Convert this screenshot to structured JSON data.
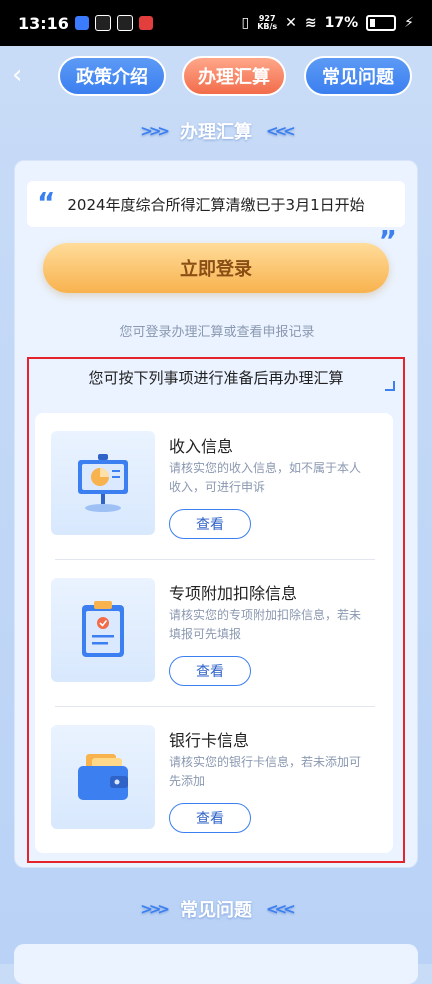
{
  "status_bar": {
    "time": "13:16",
    "speed_value": "927",
    "speed_unit": "KB/s",
    "battery": "17%"
  },
  "header": {
    "tabs": [
      {
        "label": "政策介绍"
      },
      {
        "label": "办理汇算"
      },
      {
        "label": "常见问题"
      }
    ]
  },
  "sections": {
    "handle_title": "办理汇算",
    "faq_title": "常见问题"
  },
  "notice": {
    "text": "2024年度综合所得汇算清缴已于3月1日开始"
  },
  "login": {
    "button_label": "立即登录",
    "hint": "您可登录办理汇算或查看申报记录"
  },
  "prep": {
    "title": "您可按下列事项进行准备后再办理汇算",
    "items": [
      {
        "title": "收入信息",
        "desc": "请核实您的收入信息，如不属于本人收入，可进行申诉",
        "button": "查看"
      },
      {
        "title": "专项附加扣除信息",
        "desc": "请核实您的专项附加扣除信息，若未填报可先填报",
        "button": "查看"
      },
      {
        "title": "银行卡信息",
        "desc": "请核实您的银行卡信息，若未添加可先添加",
        "button": "查看"
      }
    ]
  },
  "colors": {
    "accent": "#3b7ff0",
    "active_tab": "#f26c4a",
    "login_button": "#f8b24e",
    "highlight_border": "#e5232a"
  }
}
